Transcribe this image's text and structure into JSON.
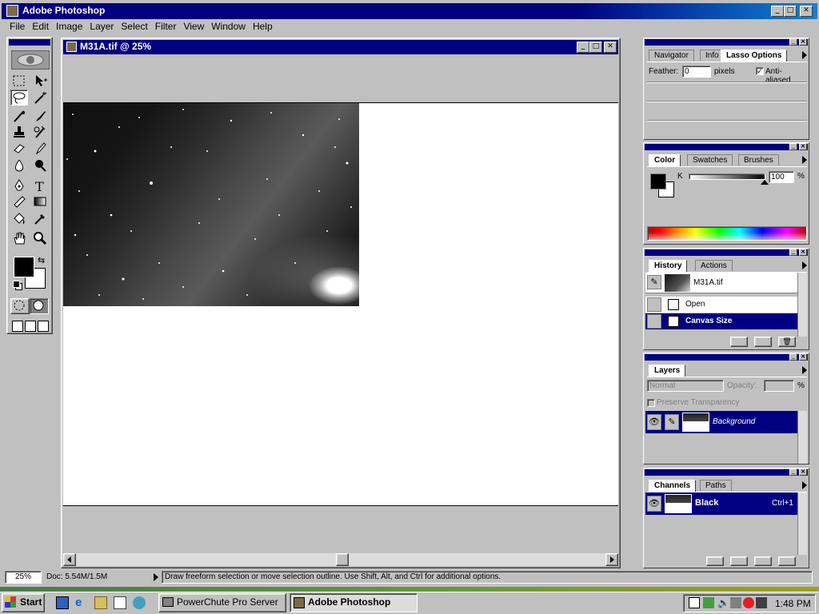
{
  "app": {
    "title": "Adobe Photoshop"
  },
  "menu": [
    "File",
    "Edit",
    "Image",
    "Layer",
    "Select",
    "Filter",
    "View",
    "Window",
    "Help"
  ],
  "document": {
    "title": "M31A.tif @ 25%"
  },
  "lasso_panel": {
    "tabs": [
      "Navigator",
      "Info",
      "Lasso Options"
    ],
    "feather_label": "Feather:",
    "feather_value": "0",
    "feather_unit": "pixels",
    "antialiased_label": "Anti-aliased"
  },
  "color_panel": {
    "tabs": [
      "Color",
      "Swatches",
      "Brushes"
    ],
    "channel_label": "K",
    "value": "100",
    "unit": "%"
  },
  "history_panel": {
    "tabs": [
      "History",
      "Actions"
    ],
    "snapshot": "M31A.tif",
    "items": [
      "Open",
      "Canvas Size"
    ]
  },
  "layers_panel": {
    "tabs": [
      "Layers"
    ],
    "mode": "Normal",
    "opacity_label": "Opacity:",
    "opacity_unit": "%",
    "preserve_label": "Preserve Transparency",
    "layer_name": "Background"
  },
  "channels_panel": {
    "tabs": [
      "Channels",
      "Paths"
    ],
    "channel_name": "Black",
    "shortcut": "Ctrl+1"
  },
  "status": {
    "zoom": "25%",
    "doc": "Doc: 5.54M/1.5M",
    "hint": "Draw freeform selection or move selection outline.  Use Shift, Alt, and Ctrl for additional options."
  },
  "taskbar": {
    "start": "Start",
    "tasks": [
      "PowerChute Pro Server",
      "Adobe Photoshop"
    ],
    "clock": "1:48 PM"
  },
  "colors": {
    "title_bar": "#000080",
    "chrome": "#c0c0c0",
    "desktop": "#008080"
  }
}
